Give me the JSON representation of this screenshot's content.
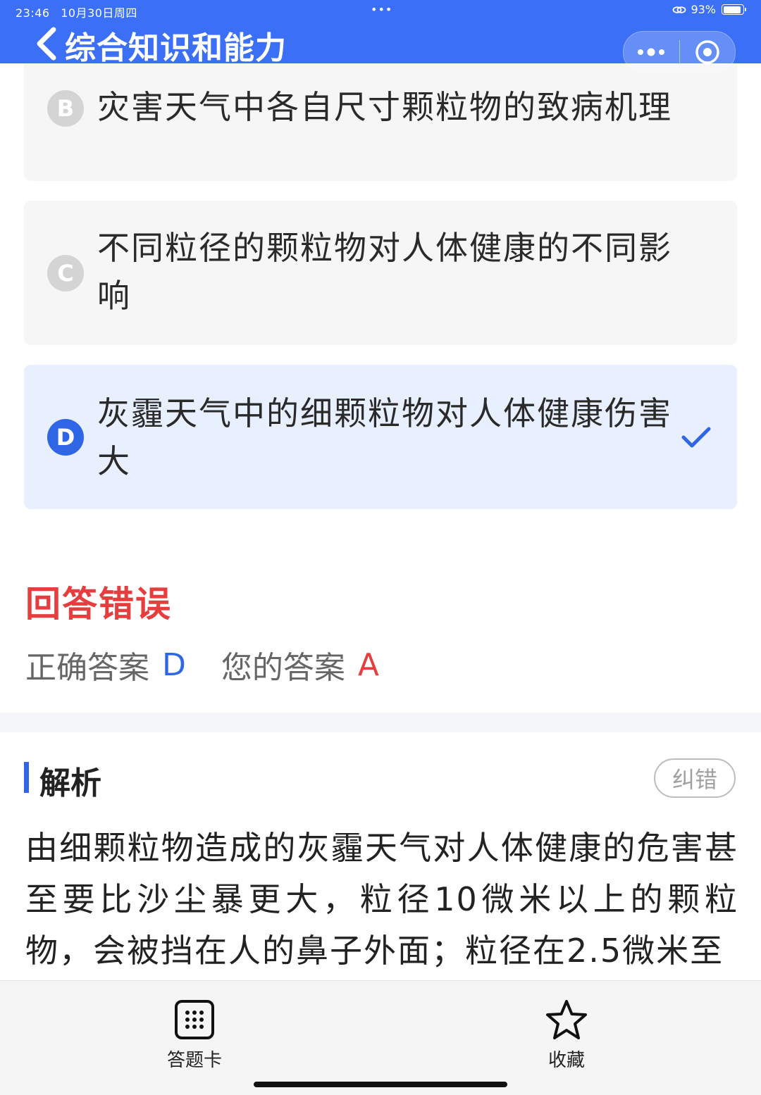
{
  "status_bar": {
    "time": "23:46",
    "date": "10月30日周四",
    "dots": "•••",
    "battery": "93%"
  },
  "nav": {
    "title": "综合知识和能力"
  },
  "options": [
    {
      "letter": "B",
      "text": "灾害天气中各自尺寸颗粒物的致病机理",
      "selected": false
    },
    {
      "letter": "C",
      "text": "不同粒径的颗粒物对人体健康的不同影响",
      "selected": false
    },
    {
      "letter": "D",
      "text": "灰霾天气中的细颗粒物对人体健康伤害大",
      "selected": true
    }
  ],
  "result": {
    "title": "回答错误",
    "correct_label": "正确答案",
    "correct_value": "D",
    "user_label": "您的答案",
    "user_value": "A"
  },
  "analysis": {
    "title": "解析",
    "report_label": "纠错",
    "text": "由细颗粒物造成的灰霾天气对人体健康的危害甚至要比沙尘暴更大，粒径10微米以上的颗粒物，会被挡在人的鼻子外面；粒径在2.5微米至"
  },
  "bottom_tabs": {
    "answer_card": "答题卡",
    "favorite": "收藏"
  },
  "colors": {
    "primary": "#3b6ff5",
    "accent_blue": "#2f66e6",
    "error_red": "#e53e3e"
  }
}
